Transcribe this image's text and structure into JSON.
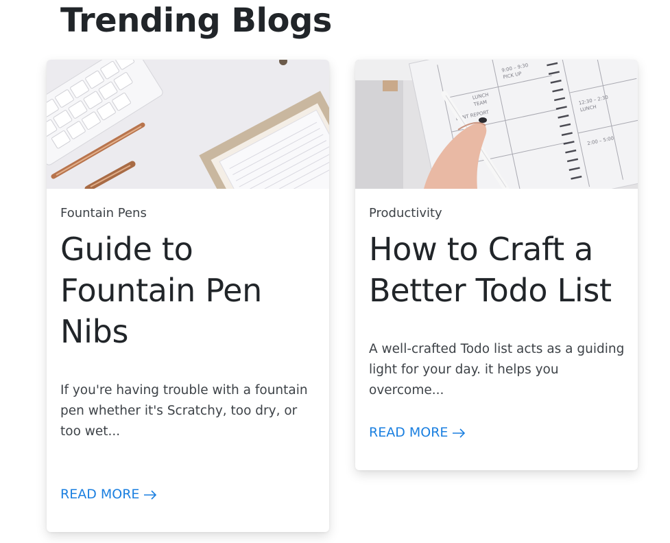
{
  "page": {
    "title": "Trending Blogs"
  },
  "cards": [
    {
      "image_icon": "desk-keyboard-pens-image",
      "category": "Fountain Pens",
      "title": "Guide to Fountain Pen Nibs",
      "excerpt": "If you're having trouble with a fountain pen whether it's Scratchy, too dry, or too wet...",
      "read_more": "READ MORE"
    },
    {
      "image_icon": "planner-hand-pen-image",
      "category": "Productivity",
      "title": "How to Craft a Better Todo List",
      "excerpt": "A well-crafted Todo list acts as a guiding light for your day. it helps you overcome...",
      "read_more": "READ MORE"
    }
  ],
  "colors": {
    "link": "#1a7fe0",
    "heading": "#212529",
    "body_text": "#3d4247",
    "card_bg": "#ffffff"
  }
}
